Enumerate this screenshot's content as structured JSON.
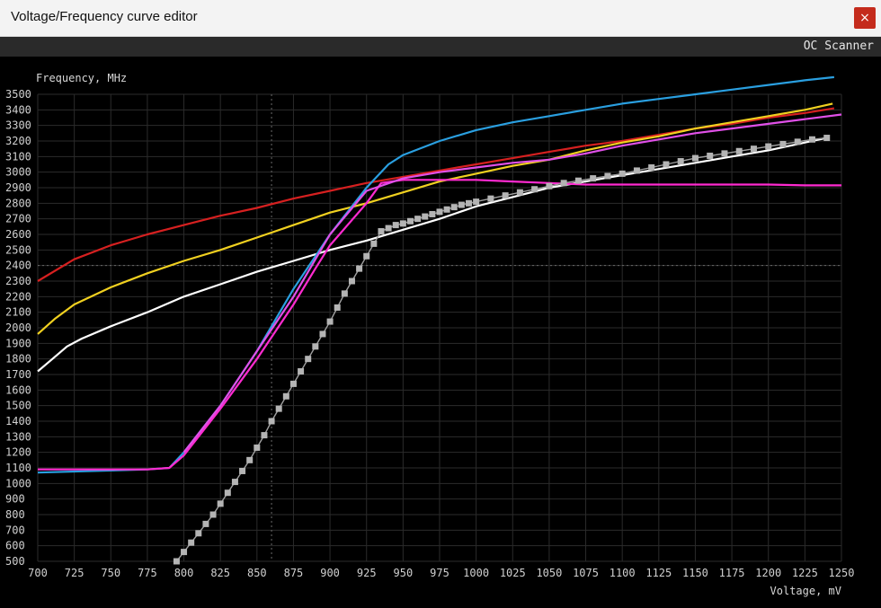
{
  "window": {
    "title": "Voltage/Frequency curve editor",
    "close_glyph": "×"
  },
  "toolbar": {
    "oc_scanner_label": "OC Scanner"
  },
  "colors": {
    "background": "#000000",
    "grid": "#2b2b2b",
    "axis_text": "#d0d0d0",
    "close": "#c42b1c"
  },
  "chart_data": {
    "type": "line",
    "title": "",
    "ylabel": "Frequency, MHz",
    "xlabel": "Voltage, mV",
    "xlim": [
      700,
      1250
    ],
    "ylim": [
      500,
      3500
    ],
    "xticks": [
      "700",
      "725",
      "750",
      "775",
      "800",
      "825",
      "850",
      "875",
      "900",
      "925",
      "950",
      "975",
      "1000",
      "1025",
      "1050",
      "1075",
      "1100",
      "1125",
      "1150",
      "1175",
      "1200",
      "1225",
      "1250"
    ],
    "yticks": [
      "500",
      "600",
      "700",
      "800",
      "900",
      "1000",
      "1100",
      "1200",
      "1300",
      "1400",
      "1500",
      "1600",
      "1700",
      "1800",
      "1900",
      "2000",
      "2100",
      "2200",
      "2300",
      "2400",
      "2500",
      "2600",
      "2700",
      "2800",
      "2900",
      "3000",
      "3100",
      "3200",
      "3300",
      "3400",
      "3500"
    ],
    "grid": true,
    "reference_lines": {
      "x": 860,
      "y": 2400
    },
    "legend": "none",
    "series": [
      {
        "color": "#d62020",
        "x": [
          700,
          725,
          750,
          775,
          800,
          825,
          850,
          875,
          900,
          925,
          950,
          975,
          1000,
          1025,
          1050,
          1075,
          1100,
          1125,
          1150,
          1175,
          1200,
          1225,
          1245
        ],
        "y": [
          2300,
          2440,
          2530,
          2600,
          2660,
          2720,
          2770,
          2830,
          2880,
          2930,
          2970,
          3010,
          3050,
          3090,
          3130,
          3170,
          3200,
          3240,
          3280,
          3310,
          3350,
          3380,
          3410
        ]
      },
      {
        "color": "#f0d020",
        "x": [
          700,
          712,
          725,
          750,
          775,
          800,
          825,
          850,
          875,
          900,
          925,
          950,
          975,
          1000,
          1025,
          1050,
          1075,
          1100,
          1125,
          1150,
          1175,
          1200,
          1225,
          1244
        ],
        "y": [
          1960,
          2060,
          2150,
          2260,
          2350,
          2430,
          2500,
          2580,
          2660,
          2740,
          2800,
          2870,
          2940,
          2990,
          3040,
          3080,
          3140,
          3190,
          3230,
          3280,
          3320,
          3360,
          3400,
          3440
        ]
      },
      {
        "color": "#ffffff",
        "x": [
          700,
          710,
          720,
          730,
          750,
          775,
          800,
          825,
          850,
          875,
          900,
          925,
          950,
          975,
          1000,
          1025,
          1050,
          1075,
          1100,
          1125,
          1150,
          1175,
          1200,
          1225,
          1240
        ],
        "y": [
          1720,
          1800,
          1880,
          1930,
          2010,
          2100,
          2200,
          2280,
          2360,
          2430,
          2500,
          2560,
          2630,
          2700,
          2780,
          2840,
          2900,
          2940,
          2980,
          3020,
          3060,
          3100,
          3140,
          3190,
          3220
        ]
      },
      {
        "color": "#2a9fe0",
        "x": [
          700,
          775,
          790,
          800,
          825,
          850,
          875,
          900,
          925,
          940,
          950,
          975,
          1000,
          1025,
          1050,
          1075,
          1100,
          1125,
          1150,
          1175,
          1200,
          1225,
          1245
        ],
        "y": [
          1070,
          1090,
          1100,
          1200,
          1500,
          1850,
          2250,
          2600,
          2900,
          3050,
          3110,
          3200,
          3270,
          3320,
          3360,
          3400,
          3440,
          3470,
          3500,
          3530,
          3560,
          3590,
          3610
        ]
      },
      {
        "color": "#ff2ad0",
        "x": [
          700,
          775,
          790,
          800,
          825,
          850,
          875,
          890,
          900,
          925,
          935,
          950,
          975,
          1000,
          1025,
          1050,
          1075,
          1100,
          1125,
          1150,
          1175,
          1200,
          1225,
          1245,
          1250
        ],
        "y": [
          1090,
          1090,
          1100,
          1180,
          1480,
          1800,
          2150,
          2380,
          2530,
          2800,
          2930,
          2950,
          2950,
          2950,
          2940,
          2930,
          2920,
          2920,
          2920,
          2920,
          2920,
          2920,
          2915,
          2915,
          2915
        ]
      },
      {
        "color": "#e050e8",
        "x": [
          800,
          825,
          850,
          875,
          900,
          925,
          950,
          975,
          1000,
          1025,
          1050,
          1075,
          1100,
          1125,
          1150,
          1175,
          1200,
          1225,
          1250
        ],
        "y": [
          1200,
          1500,
          1850,
          2200,
          2600,
          2880,
          2960,
          3000,
          3030,
          3060,
          3080,
          3120,
          3170,
          3210,
          3250,
          3280,
          3310,
          3340,
          3370
        ]
      },
      {
        "color": "#a0a0a0",
        "markers": "square",
        "x": [
          795,
          800,
          805,
          810,
          815,
          820,
          825,
          830,
          835,
          840,
          845,
          850,
          855,
          860,
          865,
          870,
          875,
          880,
          885,
          890,
          895,
          900,
          905,
          910,
          915,
          920,
          925,
          930,
          935,
          940,
          945,
          950,
          955,
          960,
          965,
          970,
          975,
          980,
          985,
          990,
          995,
          1000,
          1010,
          1020,
          1030,
          1040,
          1050,
          1060,
          1070,
          1080,
          1090,
          1100,
          1110,
          1120,
          1130,
          1140,
          1150,
          1160,
          1170,
          1180,
          1190,
          1200,
          1210,
          1220,
          1230,
          1240
        ],
        "y": [
          500,
          560,
          620,
          680,
          740,
          800,
          870,
          940,
          1010,
          1080,
          1150,
          1230,
          1310,
          1400,
          1480,
          1560,
          1640,
          1720,
          1800,
          1880,
          1960,
          2040,
          2130,
          2220,
          2300,
          2380,
          2460,
          2540,
          2620,
          2640,
          2660,
          2670,
          2685,
          2700,
          2715,
          2730,
          2745,
          2760,
          2775,
          2790,
          2800,
          2810,
          2830,
          2850,
          2870,
          2890,
          2910,
          2930,
          2945,
          2960,
          2975,
          2990,
          3010,
          3030,
          3050,
          3070,
          3090,
          3105,
          3120,
          3135,
          3150,
          3165,
          3180,
          3195,
          3210,
          3220
        ]
      }
    ]
  }
}
